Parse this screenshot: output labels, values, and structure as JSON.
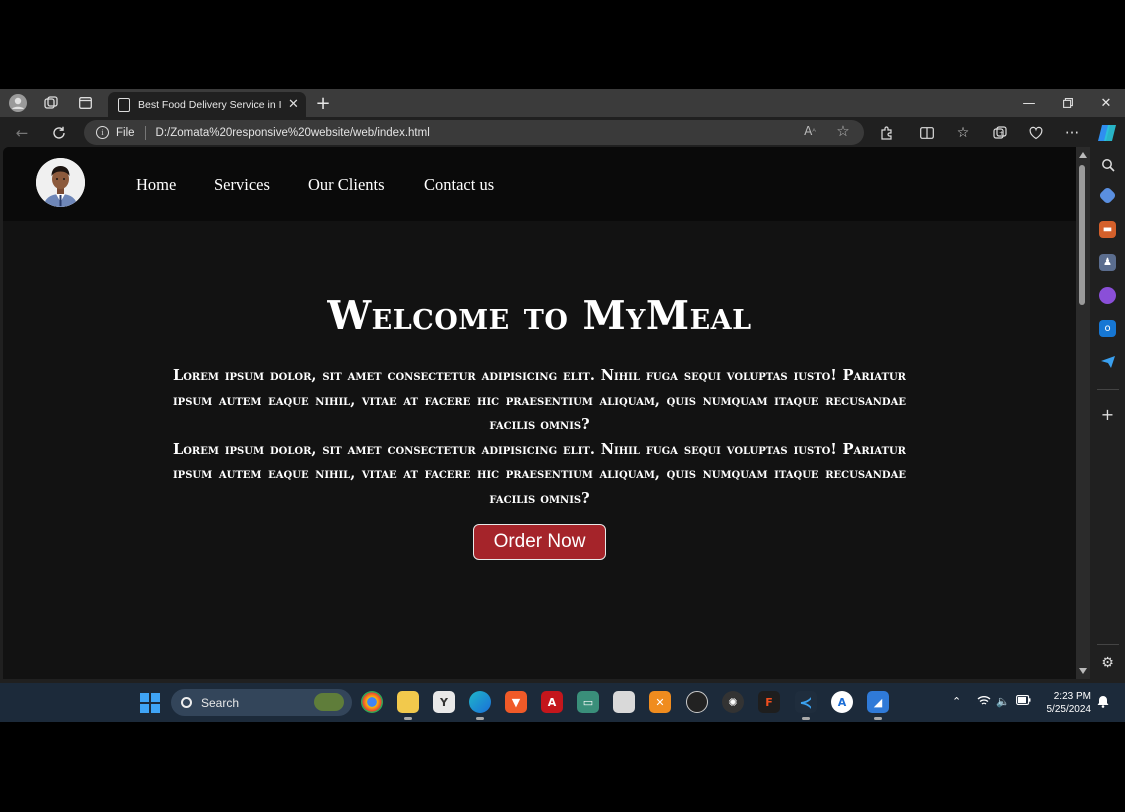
{
  "browser": {
    "tab_title": "Best Food Delivery Service in India",
    "address_scheme": "File",
    "address_url": "D:/Zomata%20responsive%20website/web/index.html"
  },
  "site": {
    "nav": [
      "Home",
      "Services",
      "Our Clients",
      "Contact us"
    ],
    "hero_title": "Welcome to MyMeal",
    "hero_paragraph_1": "Lorem ipsum dolor, sit amet consectetur adipisicing elit. Nihil fuga sequi voluptas iusto! Pariatur ipsum autem eaque nihil, vitae at facere hic praesentium aliquam, quis numquam itaque recusandae facilis omnis?",
    "hero_paragraph_2": "Lorem ipsum dolor, sit amet consectetur adipisicing elit. Nihil fuga sequi voluptas iusto! Pariatur ipsum autem eaque nihil, vitae at facere hic praesentium aliquam, quis numquam itaque recusandae facilis omnis?",
    "cta": "Order Now"
  },
  "taskbar": {
    "search_label": "Search",
    "time": "2:23 PM",
    "date": "5/25/2024"
  },
  "colors": {
    "cta_background": "#a5242a",
    "page_background": "#121212",
    "nav_background": "#0a0a0a"
  }
}
